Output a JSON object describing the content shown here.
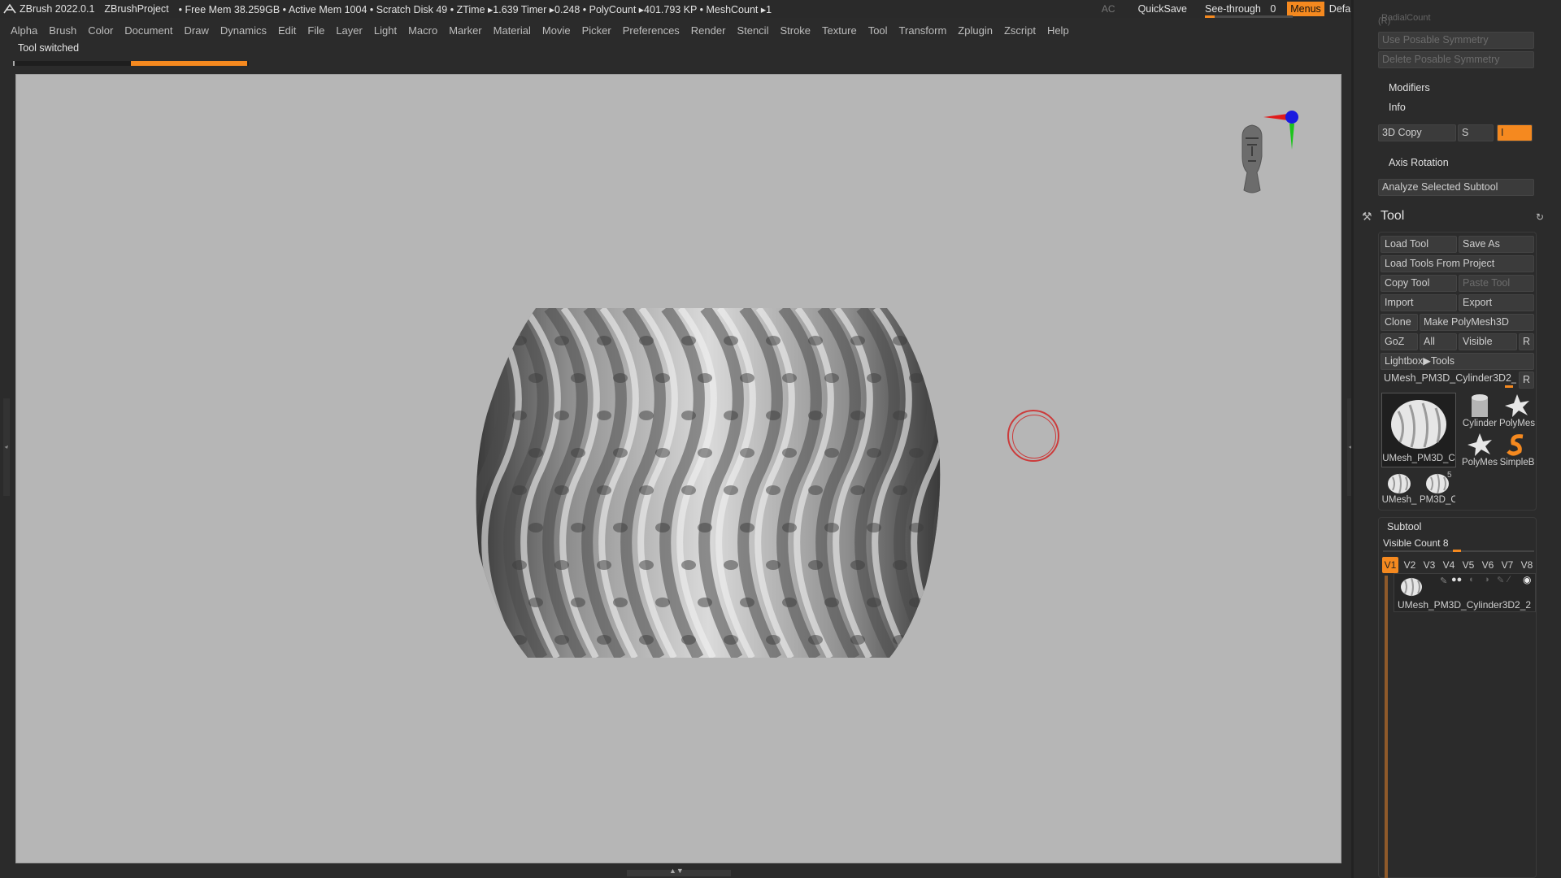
{
  "titlebar": {
    "app": "ZBrush 2022.0.1",
    "project": "ZBrushProject",
    "stats": "• Free Mem 38.259GB • Active Mem 1004 • Scratch Disk 49 • ZTime ▸1.639 Timer ▸0.248 • PolyCount ▸401.793 KP • MeshCount ▸1",
    "ac": "AC",
    "quicksave": "QuickSave",
    "seethrough": "See-through",
    "seethrough_value": "0",
    "menus": "Menus",
    "script": "DefaultZScript"
  },
  "menubar": [
    "Alpha",
    "Brush",
    "Color",
    "Document",
    "Draw",
    "Dynamics",
    "Edit",
    "File",
    "Layer",
    "Light",
    "Macro",
    "Marker",
    "Material",
    "Movie",
    "Picker",
    "Preferences",
    "Render",
    "Stencil",
    "Stroke",
    "Texture",
    "Tool",
    "Transform",
    "Zplugin",
    "Zscript",
    "Help"
  ],
  "notify": "Tool switched",
  "progress_fraction": 0.5,
  "palette": {
    "radial_count": "RadialCount",
    "radial_r": "(R)",
    "use_posable": "Use Posable Symmetry",
    "delete_posable": "Delete Posable Symmetry",
    "modifiers": "Modifiers",
    "info": "Info",
    "copy3d": "3D Copy",
    "s": "S",
    "i": "I",
    "axis_rotation": "Axis Rotation",
    "analyze": "Analyze Selected Subtool",
    "tool_title": "Tool",
    "load_tool": "Load Tool",
    "save_as": "Save As",
    "load_from_project": "Load Tools From Project",
    "copy_tool": "Copy Tool",
    "paste_tool": "Paste Tool",
    "import": "Import",
    "export": "Export",
    "clone": "Clone",
    "make_polymesh": "Make PolyMesh3D",
    "goz": "GoZ",
    "all": "All",
    "visible": "Visible",
    "r": "R",
    "lightbox_tools": "Lightbox▶Tools",
    "current_tool": "UMesh_PM3D_Cylinder3D2_2",
    "current_tool_r": "R",
    "thumbs": {
      "main": "UMesh_PM3D_C",
      "cylinder": "Cylinder",
      "polymesh1": "PolyMes",
      "polymesh2": "PolyMes",
      "simpleb": "SimpleB",
      "umesh_small": "UMesh_",
      "pm3d_small": "PM3D_C",
      "badge": "5"
    },
    "subtool": "Subtool",
    "visible_count": "Visible Count 8",
    "versions": [
      "V1",
      "V2",
      "V3",
      "V4",
      "V5",
      "V6",
      "V7",
      "V8"
    ],
    "subtool_item": "UMesh_PM3D_Cylinder3D2_2"
  },
  "colors": {
    "accent": "#f5891f",
    "viewport": "#b6b6b6",
    "panel": "#2b2b2b"
  }
}
